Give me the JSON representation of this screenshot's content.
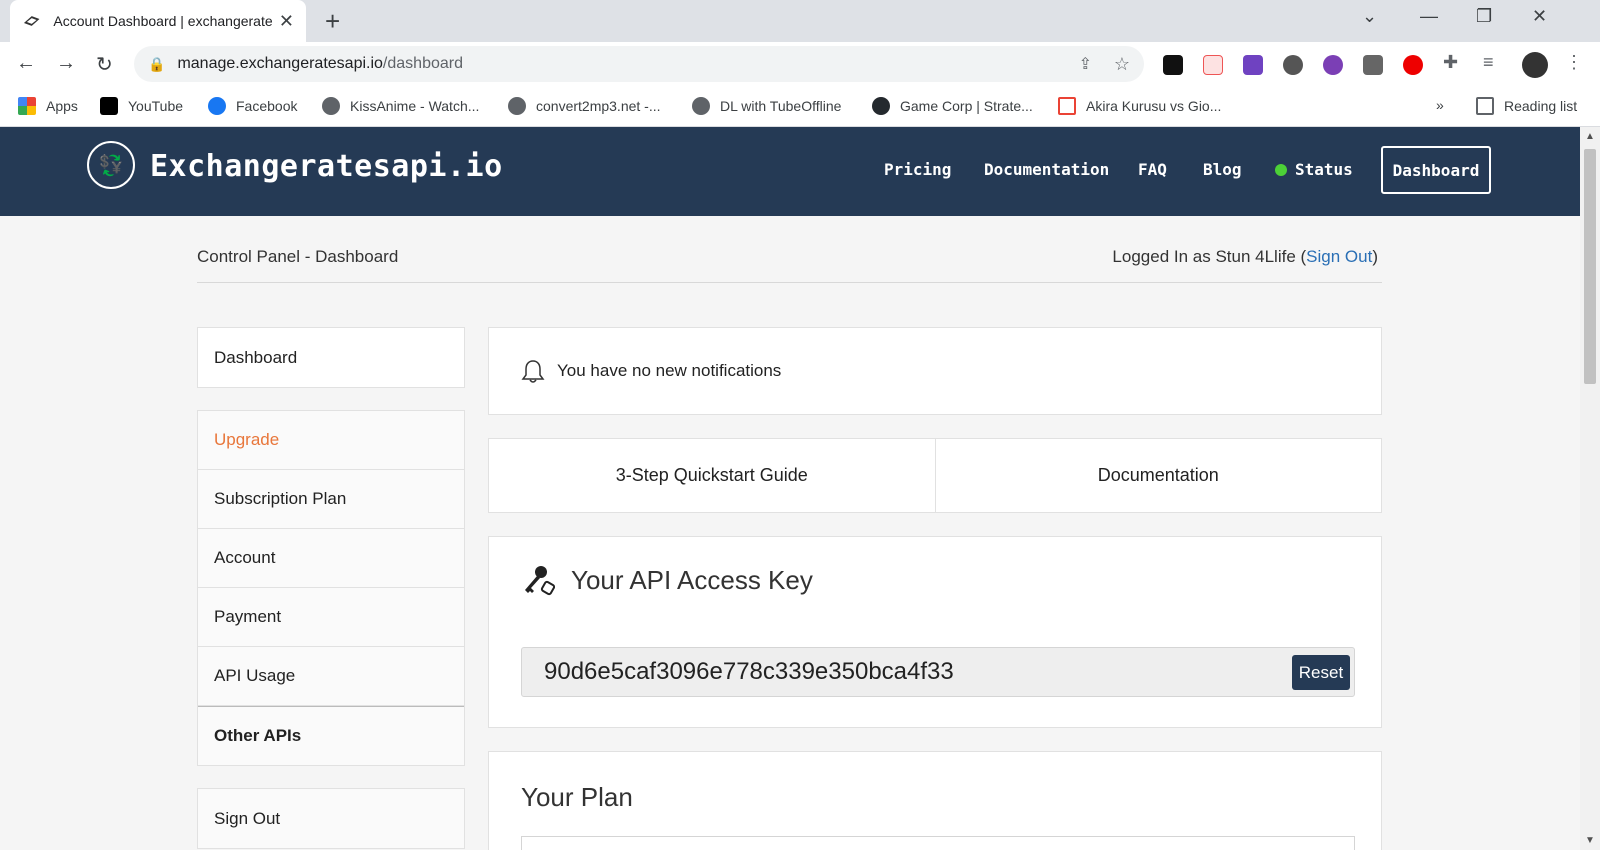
{
  "browser": {
    "tab_title": "Account Dashboard | exchangerates",
    "url_host": "manage.exchangeratesapi.io",
    "url_path": "/dashboard",
    "bookmarks": [
      {
        "label": "Apps",
        "color": "#ea4335"
      },
      {
        "label": "YouTube",
        "color": "#000000"
      },
      {
        "label": "Facebook",
        "color": "#1877f2"
      },
      {
        "label": "KissAnime - Watch...",
        "color": "#5f6368"
      },
      {
        "label": "convert2mp3.net -...",
        "color": "#5f6368"
      },
      {
        "label": "DL with TubeOffline",
        "color": "#5f6368"
      },
      {
        "label": "Game Corp | Strate...",
        "color": "#24292e"
      },
      {
        "label": "Akira Kurusu vs Gio...",
        "color": "#ea4335"
      }
    ],
    "more_bookmarks": "»",
    "reading_list": "Reading list"
  },
  "site": {
    "brand": "Exchangeratesapi.io",
    "nav": {
      "pricing": "Pricing",
      "documentation": "Documentation",
      "faq": "FAQ",
      "blog": "Blog",
      "status": "Status",
      "dashboard": "Dashboard"
    },
    "breadcrumb": "Control Panel - Dashboard",
    "logged_in_prefix": "Logged In as Stun 4Llife (",
    "sign_out_link": "Sign Out",
    "logged_in_suffix": ")",
    "sidebar_top": "Dashboard",
    "sidebar_items": [
      "Upgrade",
      "Subscription Plan",
      "Account",
      "Payment",
      "API Usage",
      "Other APIs"
    ],
    "sidebar_bottom": "Sign Out",
    "notification": "You have no new notifications",
    "quickstart": "3-Step Quickstart Guide",
    "documentation": "Documentation",
    "api_key_title": "Your API Access Key",
    "api_key": "90d6e5caf3096e778c339e350bca4f33",
    "reset": "Reset",
    "plan_title": "Your Plan",
    "colors": {
      "header": "#253a55",
      "accent_orange": "#e8763a",
      "link": "#2a6fb5",
      "status": "#4cd137"
    }
  }
}
